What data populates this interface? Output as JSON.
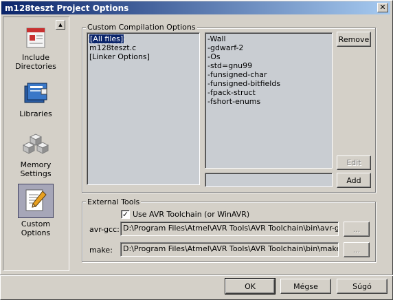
{
  "window": {
    "title": "m128teszt Project Options",
    "close_glyph": "✕"
  },
  "sidebar": {
    "scroll_glyph": "▲",
    "items": [
      {
        "label": "Include Directories",
        "icon": "include-directories-icon"
      },
      {
        "label": "Libraries",
        "icon": "libraries-icon"
      },
      {
        "label": "Memory Settings",
        "icon": "memory-settings-icon"
      },
      {
        "label": "Custom Options",
        "icon": "custom-options-icon",
        "selected": true
      }
    ]
  },
  "custom_compilation": {
    "group_label": "Custom Compilation Options",
    "files": [
      "[All files]",
      "m128teszt.c",
      "[Linker Options]"
    ],
    "selected_file": "[All files]",
    "options": [
      "-Wall",
      "-gdwarf-2",
      "-Os",
      "-std=gnu99",
      "-funsigned-char",
      "-funsigned-bitfields",
      "-fpack-struct",
      "-fshort-enums"
    ],
    "option_input_value": "",
    "remove_label": "Remove",
    "edit_label": "Edit",
    "add_label": "Add"
  },
  "external_tools": {
    "group_label": "External Tools",
    "use_toolchain_label": "Use AVR Toolchain (or WinAVR)",
    "use_toolchain_checked": true,
    "avr_gcc_label": "avr-gcc:",
    "avr_gcc_path": "D:\\Program Files\\Atmel\\AVR Tools\\AVR Toolchain\\bin\\avr-gcc.ex",
    "make_label": "make:",
    "make_path": "D:\\Program Files\\Atmel\\AVR Tools\\AVR Toolchain\\bin\\make.exe",
    "browse_label": "..."
  },
  "footer": {
    "ok_label": "OK",
    "cancel_label": "Mégse",
    "help_label": "Súgó"
  }
}
